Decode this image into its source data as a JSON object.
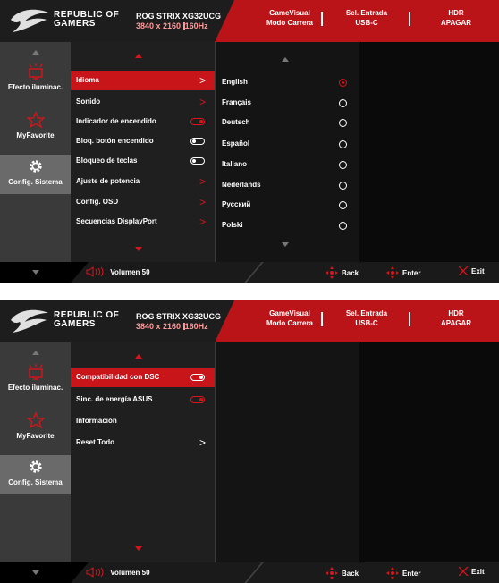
{
  "header": {
    "brand_line1": "REPUBLIC OF",
    "brand_line2": "GAMERS",
    "model": "ROG STRIX XG32UCG",
    "resolution": "3840 x 2160",
    "refresh": "160Hz",
    "items": [
      {
        "line1": "GameVisual",
        "line2": "Modo Carrera"
      },
      {
        "line1": "Sel. Entrada",
        "line2": "USB-C"
      },
      {
        "line1": "HDR",
        "line2": "APAGAR"
      }
    ]
  },
  "sidebar": {
    "items": [
      {
        "label": "Efecto iluminac.",
        "icon": "lighting-effect-icon"
      },
      {
        "label": "MyFavorite",
        "icon": "star-icon"
      },
      {
        "label": "Config. Sistema",
        "icon": "gear-icon"
      }
    ]
  },
  "screen1": {
    "menu": [
      {
        "label": "Idioma",
        "control": "chevron",
        "active": true
      },
      {
        "label": "Sonido",
        "control": "chevron"
      },
      {
        "label": "Indicador de encendido",
        "control": "toggle-on"
      },
      {
        "label": "Bloq. botón encendido",
        "control": "toggle-off"
      },
      {
        "label": "Bloqueo de teclas",
        "control": "toggle-off"
      },
      {
        "label": "Ajuste de potencia",
        "control": "chevron"
      },
      {
        "label": "Config. OSD",
        "control": "chevron"
      },
      {
        "label": "Secuencias DisplayPort",
        "control": "chevron"
      }
    ],
    "languages": [
      {
        "label": "English",
        "selected": true
      },
      {
        "label": "Français"
      },
      {
        "label": "Deutsch"
      },
      {
        "label": "Español"
      },
      {
        "label": "Italiano"
      },
      {
        "label": "Nederlands"
      },
      {
        "label": "Русский"
      },
      {
        "label": "Polski"
      }
    ]
  },
  "screen2": {
    "menu": [
      {
        "label": "Compatibilidad con DSC",
        "control": "toggle-white",
        "active": true
      },
      {
        "label": "Sinc. de energía ASUS",
        "control": "toggle-on"
      },
      {
        "label": "Información",
        "control": "none"
      },
      {
        "label": "Reset Todo",
        "control": "chevron-white"
      }
    ]
  },
  "footer": {
    "volume_label": "Volumen",
    "volume_value": "50",
    "back": "Back",
    "enter": "Enter",
    "exit": "Exit"
  },
  "colors": {
    "accent": "#d8151b",
    "header": "#bb1418",
    "sidebar_active": "#6a6a6a"
  }
}
